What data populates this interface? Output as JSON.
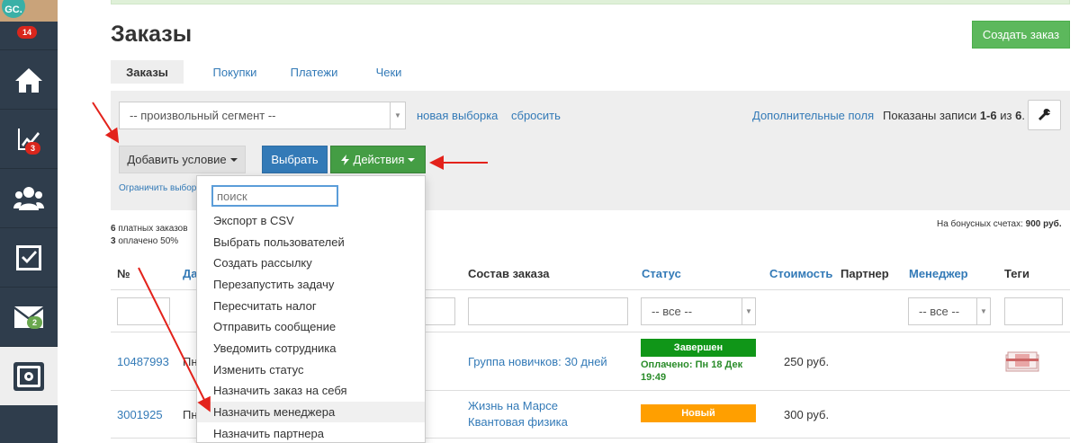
{
  "sidebar": {
    "avatar_initials": "GC.",
    "notifications_badge": "14",
    "items": [
      {
        "icon": "home-icon"
      },
      {
        "icon": "chart-icon",
        "badge": "3",
        "badge_color": "#d9261c"
      },
      {
        "icon": "users-icon"
      },
      {
        "icon": "tasks-icon"
      },
      {
        "icon": "mail-icon",
        "badge": "2",
        "badge_color": "#6aa84f"
      },
      {
        "icon": "safe-icon",
        "active": true
      }
    ]
  },
  "header": {
    "title": "Заказы",
    "create_button": "Создать заказ"
  },
  "tabs": [
    "Заказы",
    "Покупки",
    "Платежи",
    "Чеки"
  ],
  "filter": {
    "segment_value": "-- произвольный сегмент --",
    "new_selection": "новая выборка",
    "reset": "сбросить",
    "extra_fields": "Дополнительные поля",
    "shown_prefix": "Показаны записи ",
    "shown_range": "1-6",
    "shown_mid": " из ",
    "shown_total": "6",
    "shown_suffix": ".",
    "add_condition": "Добавить условие",
    "select": "Выбрать",
    "actions": "Действия",
    "limit_link": "Ограничить выбор"
  },
  "stats": {
    "paid_orders_count": "6",
    "paid_orders_label": " платных заказов",
    "paid_percent_count": "3",
    "paid_percent_label": " оплачено 50%",
    "bonus_label": "На бонусных счетах: ",
    "bonus_value": "900 руб."
  },
  "table": {
    "headers": {
      "number": "№",
      "date": "Да",
      "composition": "Состав заказа",
      "status": "Статус",
      "cost": "Стоимость",
      "partner": "Партнер",
      "manager": "Менеджер",
      "tags": "Теги"
    },
    "status_filter": "-- все --",
    "manager_filter": "-- все --",
    "rows": [
      {
        "number": "10487993",
        "date_partial": "Пн",
        "composition": [
          "Группа новичков: 30 дней"
        ],
        "status": "Завершен",
        "status_color": "#109618",
        "paid_note": "Оплачено: Пн 18 Дек",
        "paid_time": "19:49",
        "cost": "250 руб."
      },
      {
        "number": "3001925",
        "date_partial": "Пн",
        "composition": [
          "Жизнь на Марсе",
          "Квантовая физика"
        ],
        "status": "Новый",
        "status_color": "#ff9f00",
        "cost": "300 руб."
      }
    ]
  },
  "dropdown": {
    "search_placeholder": "поиск",
    "items": [
      "Экспорт в CSV",
      "Выбрать пользователей",
      "Создать рассылку",
      "Перезапустить задачу",
      "Пересчитать налог",
      "Отправить сообщение",
      "Уведомить сотрудника",
      "Изменить статус",
      "Назначить заказ на себя",
      "Назначить менеджера",
      "Назначить партнера"
    ],
    "highlighted": "Назначить менеджера"
  },
  "colors": {
    "sidebar": "#2f3d4c",
    "link": "#337ab7",
    "green_button": "#5cb85c",
    "arrow": "#e3221b"
  }
}
